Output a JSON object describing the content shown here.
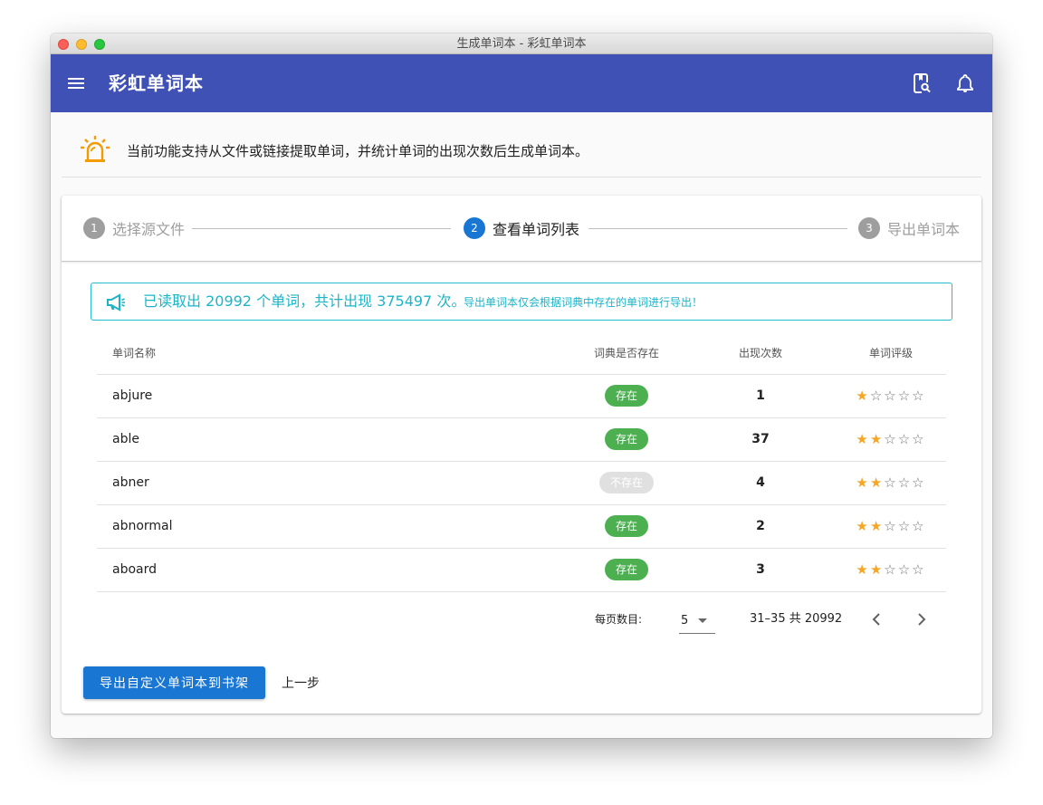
{
  "window": {
    "title": "生成单词本 - 彩虹单词本"
  },
  "appbar": {
    "title": "彩虹单词本"
  },
  "notice": {
    "text": "当前功能支持从文件或链接提取单词，并统计单词的出现次数后生成单词本。"
  },
  "stepper": {
    "steps": [
      {
        "number": "1",
        "label": "选择源文件",
        "state": "inactive"
      },
      {
        "number": "2",
        "label": "查看单词列表",
        "state": "active"
      },
      {
        "number": "3",
        "label": "导出单词本",
        "state": "inactive"
      }
    ]
  },
  "banner": {
    "main": "已读取出 20992 个单词，共计出现 375497 次。",
    "sub": "导出单词本仅会根据词典中存在的单词进行导出！"
  },
  "table": {
    "headers": [
      "单词名称",
      "词典是否存在",
      "出现次数",
      "单词评级"
    ],
    "rows": [
      {
        "word": "abjure",
        "dict": "存在",
        "exists": true,
        "count": "1",
        "rating": 1
      },
      {
        "word": "able",
        "dict": "存在",
        "exists": true,
        "count": "37",
        "rating": 2
      },
      {
        "word": "abner",
        "dict": "不存在",
        "exists": false,
        "count": "4",
        "rating": 2
      },
      {
        "word": "abnormal",
        "dict": "存在",
        "exists": true,
        "count": "2",
        "rating": 2
      },
      {
        "word": "aboard",
        "dict": "存在",
        "exists": true,
        "count": "3",
        "rating": 2
      }
    ],
    "max_rating": 5
  },
  "pagination": {
    "rows_label": "每页数目:",
    "rows_per_page": "5",
    "range": "31–35 共 20992"
  },
  "actions": {
    "export_label": "导出自定义单词本到书架",
    "back_label": "上一步"
  },
  "colors": {
    "appbar": "#3f51b5",
    "primary": "#1976d2",
    "success": "#4caf50",
    "info": "#1eb4c8",
    "star": "#f5a623",
    "alarm": "#f59a00"
  },
  "icons": [
    "menu-icon",
    "search-book-icon",
    "bell-icon",
    "alarm-icon",
    "megaphone-icon",
    "star-icon",
    "caret-down-icon",
    "chevron-left-icon",
    "chevron-right-icon"
  ]
}
